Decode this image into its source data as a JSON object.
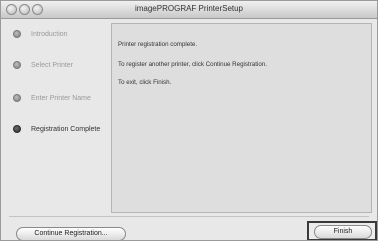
{
  "window": {
    "title": "imagePROGRAF PrinterSetup"
  },
  "steps": [
    {
      "label": "Introduction",
      "active": false
    },
    {
      "label": "Select Printer",
      "active": false
    },
    {
      "label": "Enter Printer Name",
      "active": false
    },
    {
      "label": "Registration Complete",
      "active": true
    }
  ],
  "content": {
    "line1": "Printer registration complete.",
    "line2": "To register another printer, click Continue Registration.",
    "line3": "To exit, click Finish."
  },
  "buttons": {
    "continue_label": "Continue Registration...",
    "finish_label": "Finish"
  }
}
